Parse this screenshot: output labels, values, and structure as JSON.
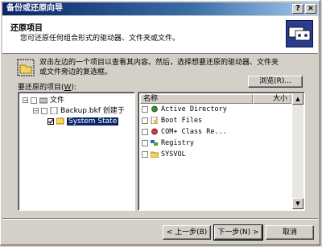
{
  "window": {
    "title": "备份或还原向导",
    "controls": [
      "?",
      "×"
    ]
  },
  "header": {
    "title": "还原项目",
    "subtitle": "您可还原任何组合形式的驱动器、文件夹或文件。"
  },
  "hint": {
    "text": "双击左边的一个项目以查看其内容。然后，选择想要还原的驱动器、文件夹或文件旁边的复选框。"
  },
  "tree": {
    "label": "要还原的项目(",
    "label_key": "W",
    "label_end": "):",
    "nodes": [
      {
        "label": "文件",
        "expander": "−",
        "checked": false
      },
      {
        "label": "Backup.bkf 创建于",
        "expander": "−",
        "checked": false
      },
      {
        "label": "System State",
        "checked": true,
        "selected": true
      }
    ]
  },
  "browse_button": "浏览(R)...",
  "list": {
    "columns": [
      "名称",
      "大小"
    ],
    "rows": [
      {
        "name": "Active Directory",
        "icon": "directory-icon"
      },
      {
        "name": "Boot Files",
        "icon": "boot-files-icon"
      },
      {
        "name": "COM+ Class Re...",
        "icon": "com-class-icon"
      },
      {
        "name": "Registry",
        "icon": "registry-icon"
      },
      {
        "name": "SYSVOL",
        "icon": "folder-icon"
      }
    ]
  },
  "footer": {
    "back": "< 上一步(B)",
    "next": "下一步(N) >",
    "cancel": "取消"
  }
}
